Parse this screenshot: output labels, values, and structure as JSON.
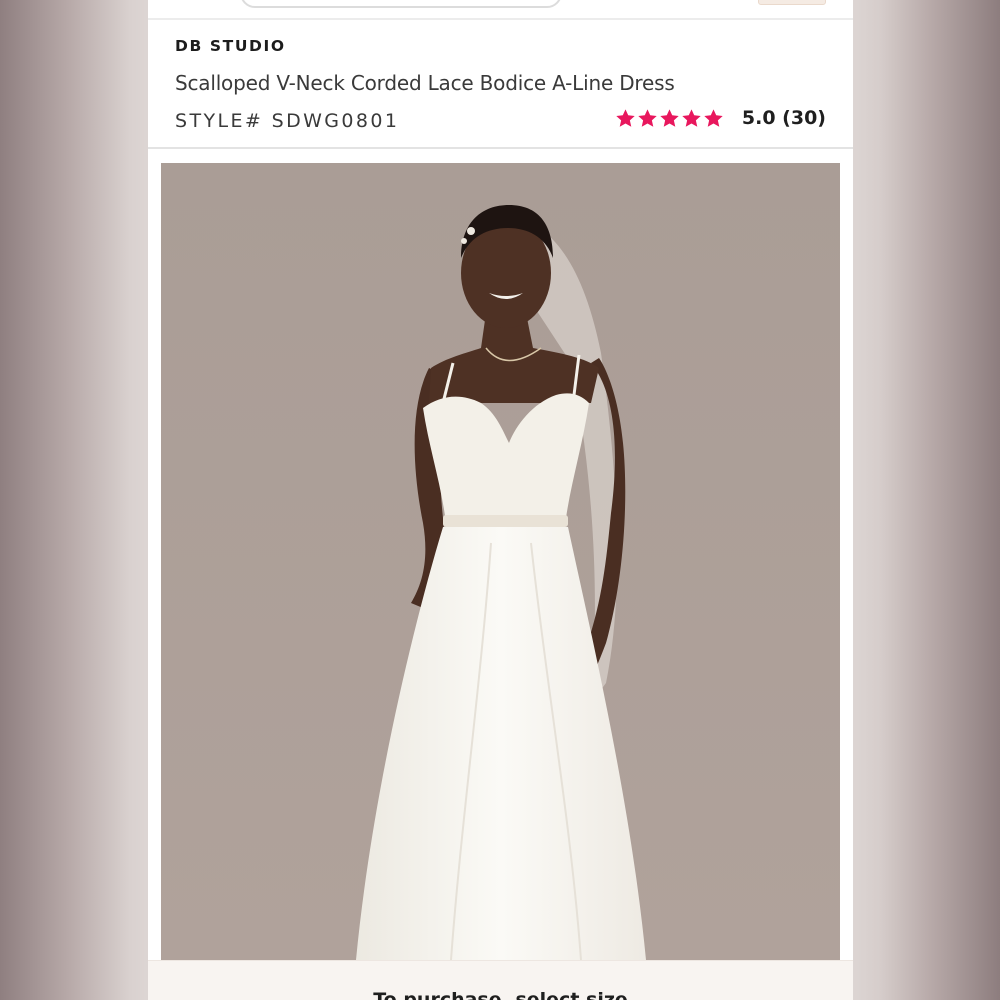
{
  "header": {
    "search_icon": "search-field",
    "cart_icon": "cart-tab"
  },
  "product": {
    "brand": "DB STUDIO",
    "title": "Scalloped V-Neck Corded Lace Bodice A-Line Dress",
    "style_number": "STYLE# SDWG0801",
    "rating": {
      "stars": 5,
      "max_stars": 5,
      "text": "5.0 (30)",
      "star_color": "#e8175d"
    },
    "image_icon": "product-photo"
  },
  "footer": {
    "purchase_hint": "To purchase, select size"
  }
}
